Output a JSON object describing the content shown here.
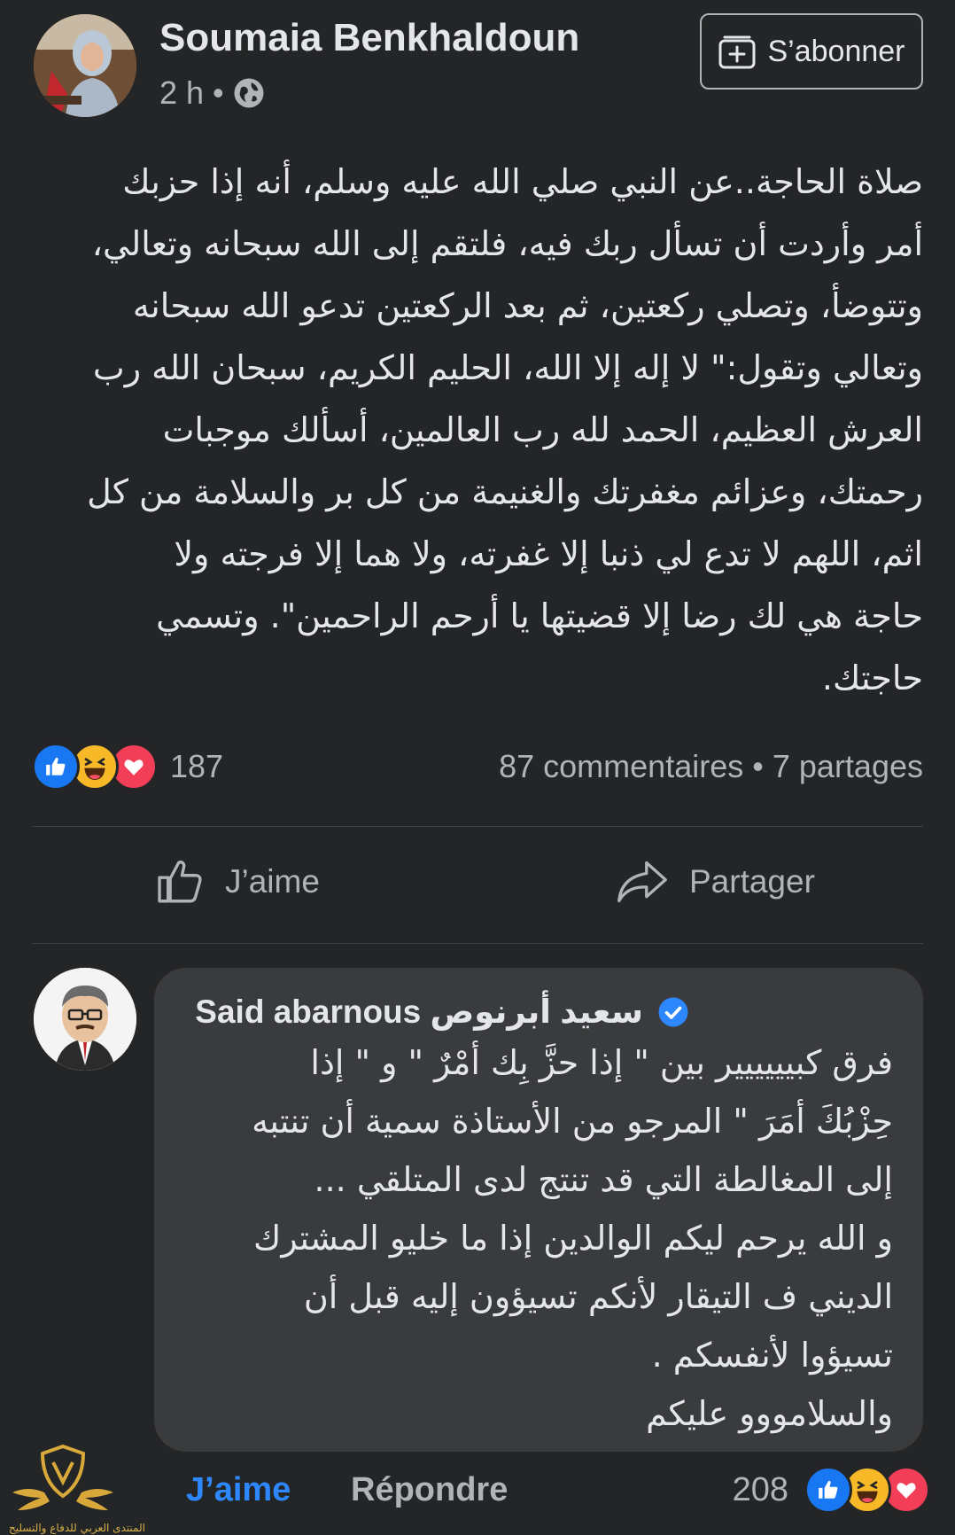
{
  "post": {
    "author": "Soumaia Benkhaldoun",
    "time": "2 h",
    "separator": "•",
    "follow_label": "S’abonner",
    "text_lines": [
      "صلاة الحاجة..عن النبي صلي الله عليه وسلم، أنه إذا حزبك",
      "أمر وأردت أن تسأل ربك فيه، فلتقم إلى الله سبحانه وتعالي،",
      "وتتوضأ، وتصلي ركعتين، ثم بعد الركعتين تدعو الله سبحانه",
      "وتعالي وتقول:\" لا إله إلا الله، الحليم الكريم، سبحان الله رب",
      "العرش العظيم، الحمد لله رب العالمين، أسألك موجبات",
      "رحمتك، وعزائم مغفرتك والغنيمة من كل بر والسلامة من كل",
      "اثم، اللهم لا تدع لي ذنبا إلا غفرته، ولا هما إلا فرجته ولا",
      "حاجة هي لك رضا إلا قضيتها يا أرحم الراحمين\". وتسمي",
      "حاجتك."
    ],
    "reaction_count": "187",
    "comments_label": "87 commentaires",
    "dot": "•",
    "shares_label": "7 partages",
    "like_label": "J’aime",
    "share_label": "Partager"
  },
  "comment": {
    "author": "Said abarnous سعيد أبرنوص",
    "text_lines": [
      "فرق كبيييييير بين \" إذا حزَّ بِك أمْرٌ \" و \" إذا",
      "حِزْبُكَ أمَرَ \" المرجو من الأستاذة سمية أن تنتبه",
      "إلى المغالطة التي قد تنتج لدى المتلقي ...",
      "و الله يرحم ليكم الوالدين إذا ما خليو المشترك",
      "الديني ف التيقار لأنكم تسيؤون إليه قبل أن",
      "تسيؤوا لأنفسكم .",
      "والسلامووو عليكم"
    ],
    "like_label": "J’aime",
    "reply_label": "Répondre",
    "reaction_count": "208"
  },
  "watermark_text": "المنتدى العربي للدفاع والتسليح",
  "colors": {
    "background": "#242526",
    "bubble": "#3a3b3c",
    "text_primary": "#e4e6eb",
    "text_secondary": "#b0b3b8",
    "accent_blue": "#2d88ff",
    "love_red": "#f33e58",
    "haha_yellow": "#f7b928"
  },
  "icons": [
    "globe-icon",
    "follow-icon",
    "like-reaction-icon",
    "haha-reaction-icon",
    "love-reaction-icon",
    "thumbs-up-icon",
    "share-arrow-icon",
    "verified-badge-icon"
  ]
}
